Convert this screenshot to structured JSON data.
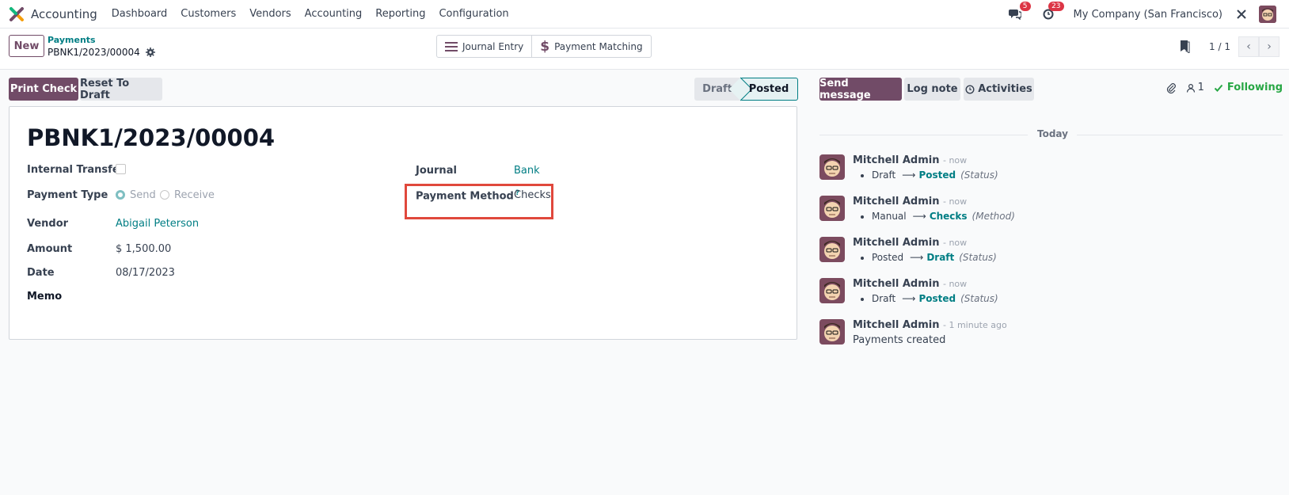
{
  "app": {
    "name": "Accounting",
    "menu": [
      "Dashboard",
      "Customers",
      "Vendors",
      "Accounting",
      "Reporting",
      "Configuration"
    ],
    "messages_badge": "5",
    "activities_badge": "23",
    "company": "My Company (San Francisco)"
  },
  "control_panel": {
    "new_label": "New",
    "breadcrumb_parent": "Payments",
    "breadcrumb_current": "PBNK1/2023/00004",
    "smart_buttons": {
      "journal_entry": "Journal Entry",
      "payment_matching": "Payment Matching"
    },
    "pager": "1 / 1"
  },
  "actions": {
    "print_check": "Print Check",
    "reset_to_draft": "Reset To Draft"
  },
  "status": {
    "steps": [
      "Draft",
      "Posted"
    ],
    "current": "Posted"
  },
  "form": {
    "title": "PBNK1/2023/00004",
    "internal_transfer_label": "Internal Transfer",
    "payment_type_label": "Payment Type",
    "payment_type_options": [
      "Send",
      "Receive"
    ],
    "payment_type_selected": "Send",
    "vendor_label": "Vendor",
    "vendor_value": "Abigail Peterson",
    "amount_label": "Amount",
    "amount_value": "$ 1,500.00",
    "date_label": "Date",
    "date_value": "08/17/2023",
    "memo_label": "Memo",
    "journal_label": "Journal",
    "journal_value": "Bank",
    "payment_method_label": "Payment Method",
    "payment_method_help": "?",
    "payment_method_value": "Checks"
  },
  "chatter": {
    "send_message": "Send message",
    "log_note": "Log note",
    "activities": "Activities",
    "followers_count": "1",
    "following": "Following",
    "day_label": "Today",
    "messages": [
      {
        "author": "Mitchell Admin",
        "time": "- now",
        "old": "Draft",
        "new": "Posted",
        "field": "(Status)"
      },
      {
        "author": "Mitchell Admin",
        "time": "- now",
        "old": "Manual",
        "new": "Checks",
        "field": "(Method)"
      },
      {
        "author": "Mitchell Admin",
        "time": "- now",
        "old": "Posted",
        "new": "Draft",
        "field": "(Status)"
      },
      {
        "author": "Mitchell Admin",
        "time": "- now",
        "old": "Draft",
        "new": "Posted",
        "field": "(Status)"
      },
      {
        "author": "Mitchell Admin",
        "time": "- 1 minute ago",
        "body": "Payments created"
      }
    ]
  },
  "colors": {
    "primary": "#714b67",
    "link": "#017e84",
    "highlight": "#e0483c",
    "success": "#28a745"
  }
}
